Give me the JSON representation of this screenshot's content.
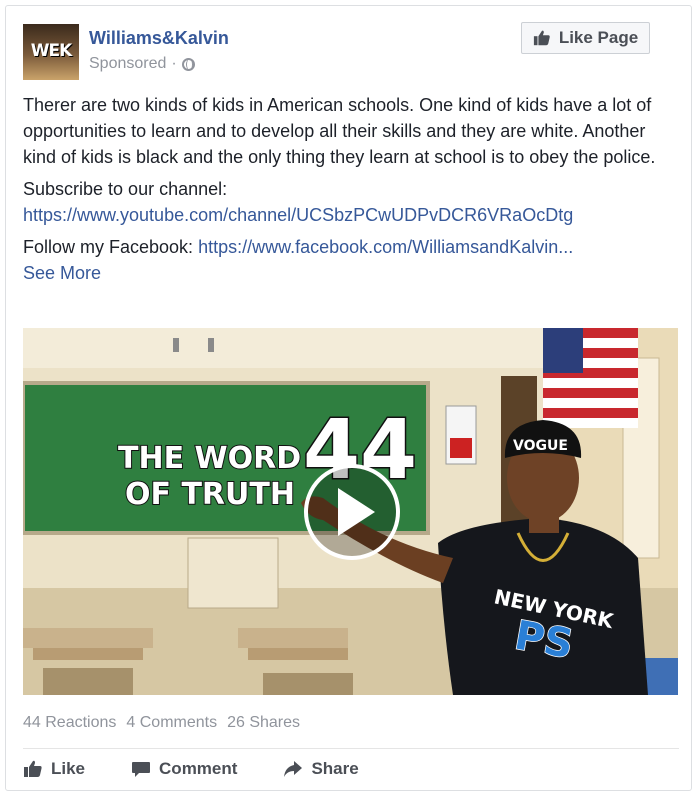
{
  "post": {
    "avatar_text": "WEK",
    "page_name": "Williams&Kalvin",
    "sponsored_label": "Sponsored",
    "meta_separator": "·",
    "like_page_label": "Like Page",
    "body_paragraph": "Therer are two kinds of kids in American schools. One kind of kids have a lot of opportunities to learn and to develop all their skills and they are white. Another kind of kids is black and the only thing they learn at school is to obey the police.",
    "subscribe_label": "Subscribe to our channel:",
    "subscribe_link": "https://www.youtube.com/channel/UCSbzPCwUDPvDCR6VRaOcDtg",
    "follow_label": "Follow my Facebook:",
    "follow_link": "https://www.facebook.com/WilliamsandKalvin...",
    "see_more_label": "See More"
  },
  "video": {
    "overlay_line1": "THE WORD",
    "overlay_line2": "OF TRUTH",
    "overlay_number": "44",
    "hat_text": "VOGUE",
    "shirt_line1": "NEW YORK",
    "shirt_line2": "PS",
    "play_icon": "play-icon"
  },
  "stats": {
    "reactions": "44 Reactions",
    "comments": "4 Comments",
    "shares": "26 Shares"
  },
  "actions": {
    "like": "Like",
    "comment": "Comment",
    "share": "Share"
  },
  "colors": {
    "link": "#365899",
    "muted": "#90949c",
    "chalkboard": "#2f8a43"
  }
}
